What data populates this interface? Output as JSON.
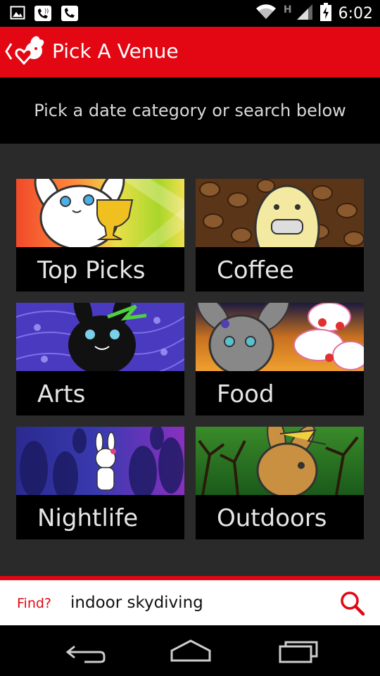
{
  "status_bar": {
    "time": "6:02",
    "network_type": "H",
    "icons": [
      "image-icon",
      "missed-call-icon",
      "call-icon",
      "wifi-icon",
      "signal-icon",
      "battery-charging-icon"
    ]
  },
  "action_bar": {
    "title": "Pick A Venue",
    "logo_icon": "heart-bunny-logo-icon",
    "back_icon": "chevron-left-icon",
    "color": "#e30613"
  },
  "subheader": {
    "text": "Pick a date category or search below"
  },
  "categories": [
    {
      "label": "Top Picks",
      "image": "bunny-with-trophy"
    },
    {
      "label": "Coffee",
      "image": "bunny-drinking-coffee"
    },
    {
      "label": "Arts",
      "image": "black-bunny-with-music-notes"
    },
    {
      "label": "Food",
      "image": "gray-bunny-with-cupcakes"
    },
    {
      "label": "Nightlife",
      "image": "bunny-on-dance-floor"
    },
    {
      "label": "Outdoors",
      "image": "brown-bunny-in-forest"
    }
  ],
  "search": {
    "label": "Find?",
    "value": "indoor skydiving",
    "icon": "search-icon"
  },
  "nav_bar": {
    "buttons": [
      "back-icon",
      "home-icon",
      "recent-apps-icon"
    ]
  }
}
